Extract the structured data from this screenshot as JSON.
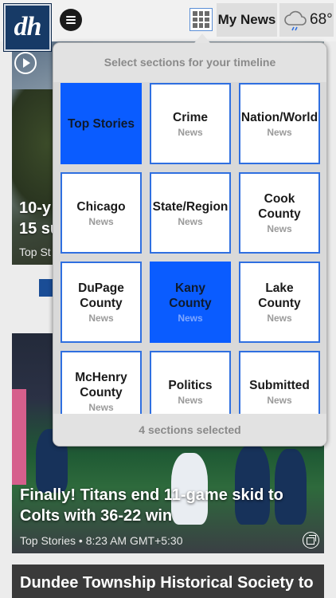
{
  "header": {
    "logo_text": "dh",
    "my_news_label": "My News",
    "temperature": "68°",
    "weather_icon": "cloud-rain-icon"
  },
  "feed": {
    "story1": {
      "headline_fragment": "10-y\n15 su",
      "meta_fragment": "Top St"
    },
    "story2": {
      "headline": "Finally! Titans end 11-game skid to Colts with 36-22 win",
      "meta": "Top Stories • 8:23 AM GMT+5:30"
    },
    "story3": {
      "headline": "Dundee Township Historical Society to"
    }
  },
  "section_picker": {
    "title": "Select sections for your timeline",
    "footer": "4 sections selected",
    "selected_color": "#0a5cff",
    "border_color": "#2f6fe0",
    "sections": [
      {
        "name": "Top Stories",
        "sub": "",
        "selected": true
      },
      {
        "name": "Crime",
        "sub": "News",
        "selected": false
      },
      {
        "name": "Nation/World",
        "sub": "News",
        "selected": false
      },
      {
        "name": "Chicago",
        "sub": "News",
        "selected": false
      },
      {
        "name": "State/Region",
        "sub": "News",
        "selected": false
      },
      {
        "name": "Cook County",
        "sub": "News",
        "selected": false
      },
      {
        "name": "DuPage County",
        "sub": "News",
        "selected": false
      },
      {
        "name": "Kany County",
        "sub": "News",
        "selected": true
      },
      {
        "name": "Lake County",
        "sub": "News",
        "selected": false
      },
      {
        "name": "McHenry County",
        "sub": "News",
        "selected": false
      },
      {
        "name": "Politics",
        "sub": "News",
        "selected": false
      },
      {
        "name": "Submitted",
        "sub": "News",
        "selected": false
      }
    ]
  }
}
